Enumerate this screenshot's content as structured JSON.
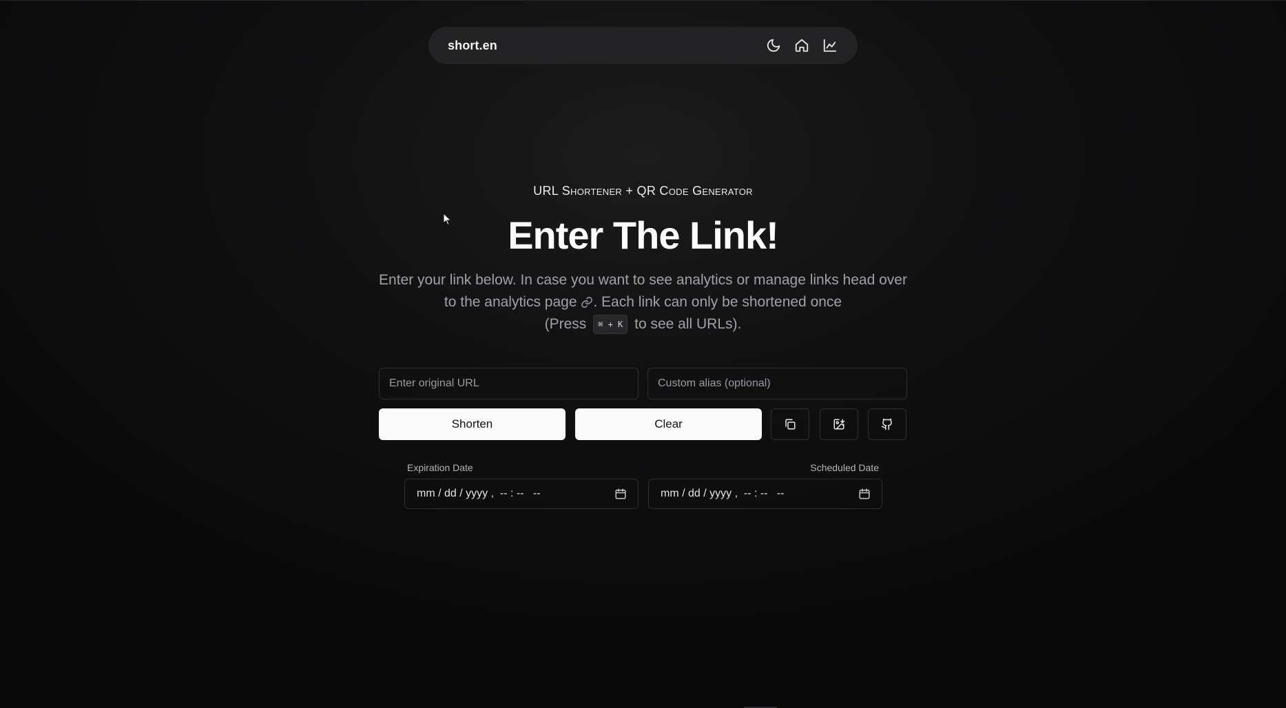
{
  "navbar": {
    "brand": "short.en",
    "icons": [
      "moon-icon",
      "home-icon",
      "chart-icon"
    ]
  },
  "hero": {
    "eyebrow": "URL Shortener + QR Code Generator",
    "title": "Enter The Link!",
    "desc_part1": "Enter your link below. In case you want to see analytics or manage links head over to the analytics page",
    "desc_part2": ". Each link can only be shortened once",
    "desc_part3": "(Press",
    "shortcut": "⌘ + K",
    "desc_part4": "to see all URLs)."
  },
  "form": {
    "url_placeholder": "Enter original URL",
    "alias_placeholder": "Custom alias (optional)",
    "shorten_label": "Shorten",
    "clear_label": "Clear",
    "icon_buttons": [
      "copy-icon",
      "image-download-icon",
      "github-icon"
    ],
    "expiration_label": "Expiration Date",
    "scheduled_label": "Scheduled Date",
    "expiration_value": "mm / dd / yyyy ,  -- : --   --",
    "scheduled_value": "mm / dd / yyyy ,  -- : --   --"
  },
  "colors": {
    "background": "#111112",
    "navbar": "#232325",
    "primary_button": "#fafafa",
    "muted_text": "#a1a1aa"
  }
}
